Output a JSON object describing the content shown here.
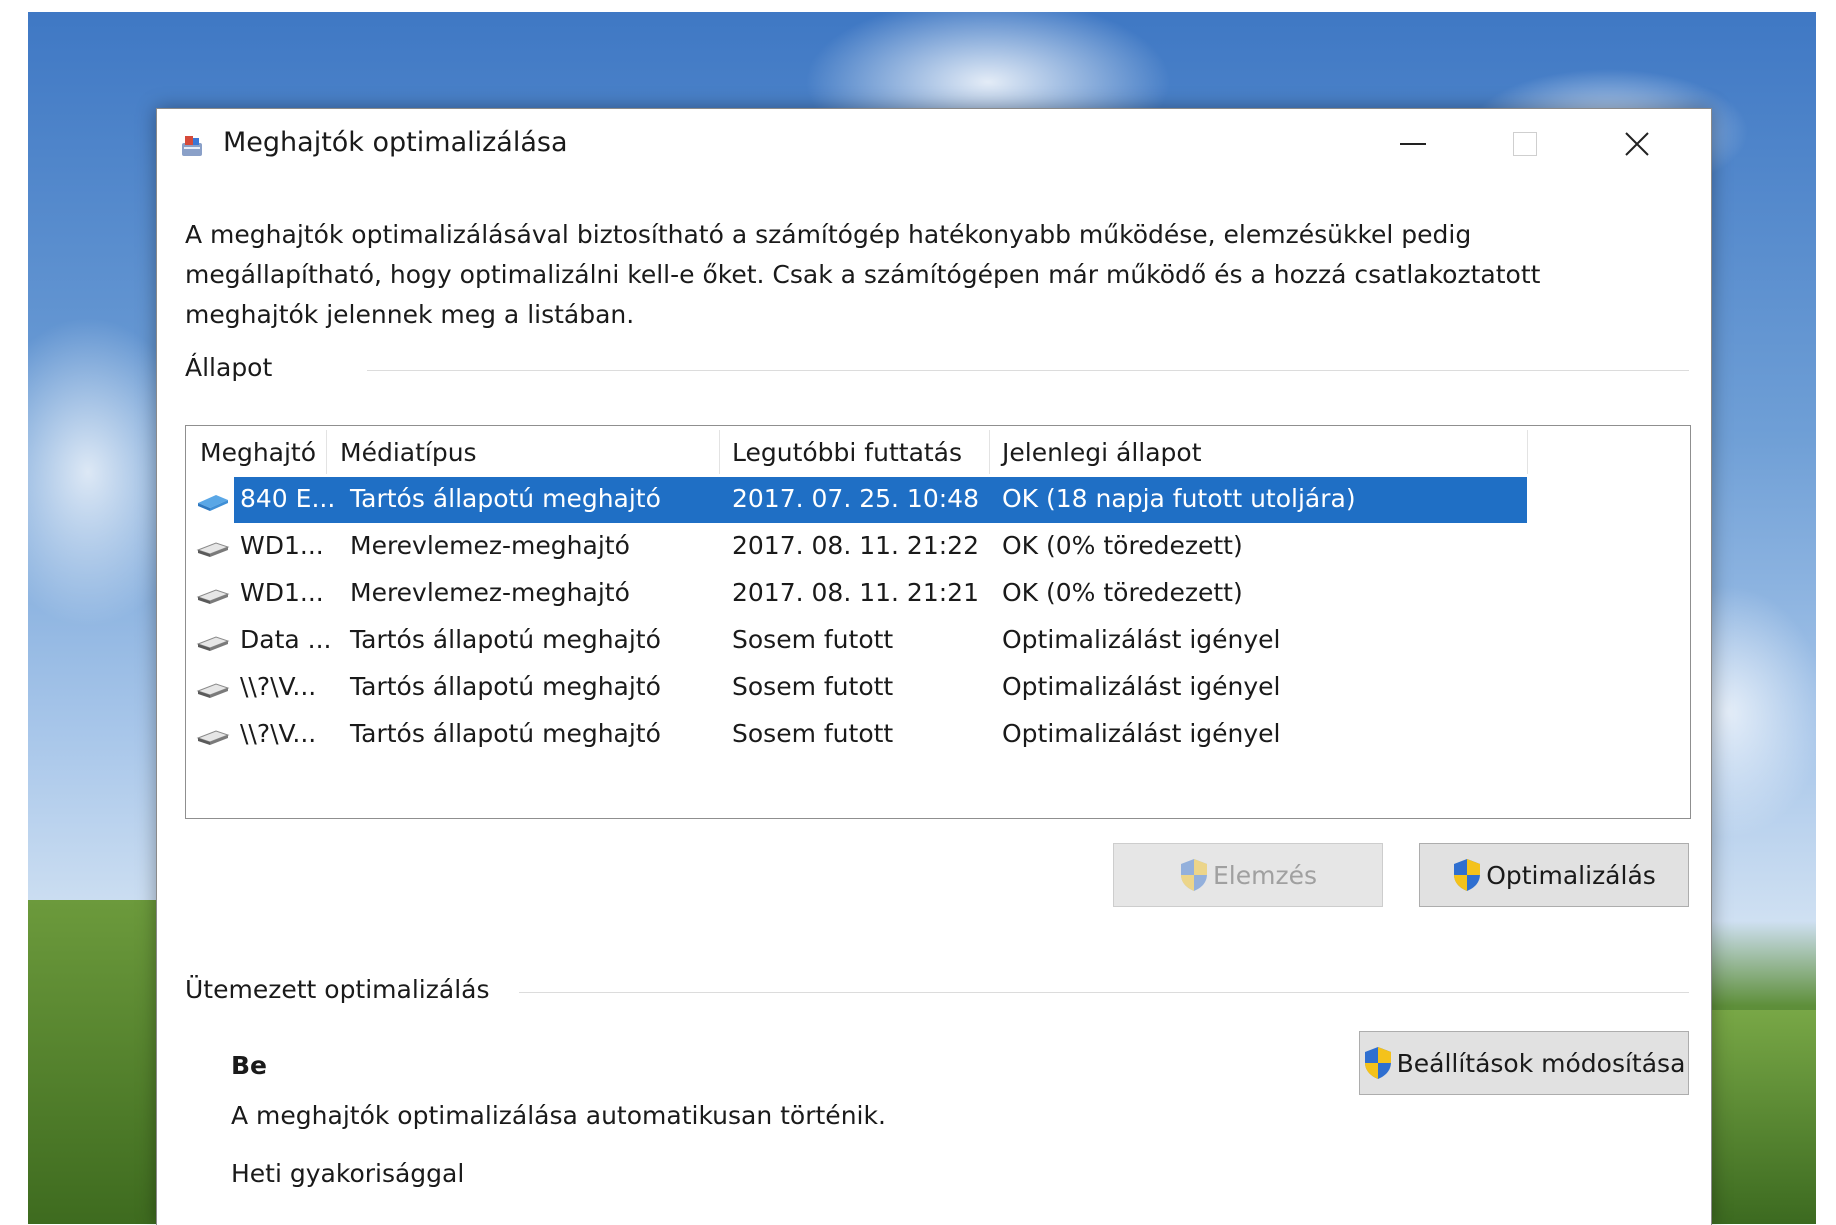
{
  "window": {
    "title": "Meghajtók optimalizálása",
    "description": "A meghajtók optimalizálásával biztosítható a számítógép hatékonyabb működése, elemzésükkel pedig megállapítható, hogy optimalizálni kell-e őket. Csak a számítógépen már működő és a hozzá csatlakoztatott meghajtók jelennek meg a listában."
  },
  "status_group": {
    "label": "Állapot",
    "columns": [
      "Meghajtó",
      "Médiatípus",
      "Legutóbbi futtatás",
      "Jelenlegi állapot"
    ],
    "rows": [
      {
        "drive": "840 E...",
        "media": "Tartós állapotú meghajtó",
        "last_run": "2017. 07. 25. 10:48",
        "status": "OK (18 napja futott utoljára)",
        "icon": "ssd-drive-icon",
        "selected": true
      },
      {
        "drive": "WD1...",
        "media": "Merevlemez-meghajtó",
        "last_run": "2017. 08. 11. 21:22",
        "status": "OK (0% töredezett)",
        "icon": "hdd-drive-icon",
        "selected": false
      },
      {
        "drive": "WD1...",
        "media": "Merevlemez-meghajtó",
        "last_run": "2017. 08. 11. 21:21",
        "status": "OK (0% töredezett)",
        "icon": "hdd-drive-icon",
        "selected": false
      },
      {
        "drive": "Data ...",
        "media": "Tartós állapotú meghajtó",
        "last_run": "Sosem futott",
        "status": "Optimalizálást igényel",
        "icon": "hdd-drive-icon",
        "selected": false
      },
      {
        "drive": "\\\\?\\V...",
        "media": "Tartós állapotú meghajtó",
        "last_run": "Sosem futott",
        "status": "Optimalizálást igényel",
        "icon": "hdd-drive-icon",
        "selected": false
      },
      {
        "drive": "\\\\?\\V...",
        "media": "Tartós állapotú meghajtó",
        "last_run": "Sosem futott",
        "status": "Optimalizálást igényel",
        "icon": "hdd-drive-icon",
        "selected": false
      }
    ],
    "analyze_button": "Elemzés",
    "optimize_button": "Optimalizálás"
  },
  "schedule_group": {
    "label": "Ütemezett optimalizálás",
    "status": "Be",
    "description": "A meghajtók optimalizálása automatikusan történik.",
    "frequency": "Heti gyakorisággal",
    "change_settings_button": "Beállítások módosítása"
  },
  "colors": {
    "selection": "#1f6fc5",
    "shield_blue": "#2f6fd0",
    "shield_yellow": "#f4c21b"
  }
}
